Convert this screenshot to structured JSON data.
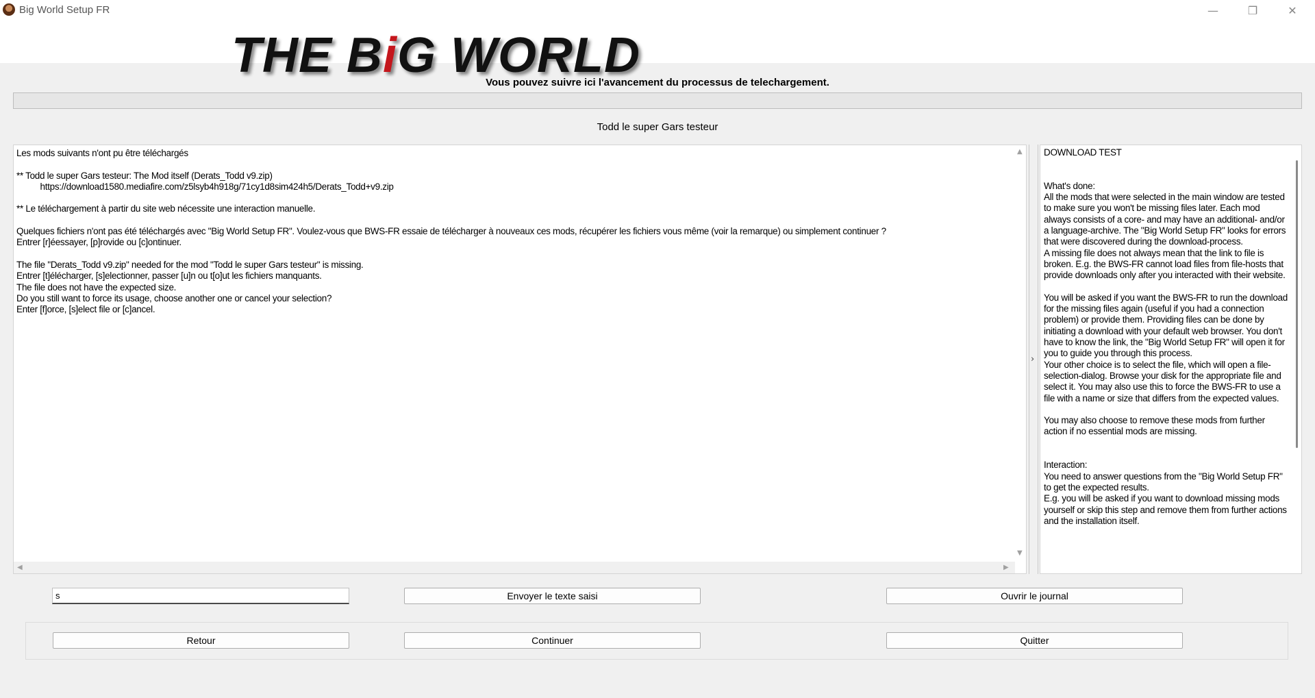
{
  "window": {
    "title": "Big World Setup FR",
    "controls": {
      "minimize": "—",
      "maximize": "❐",
      "close": "✕"
    }
  },
  "banner": {
    "logo_part1": "THE B",
    "logo_red_letter": "i",
    "logo_part2": "G WORLD",
    "logo_red_color": "#c4161c"
  },
  "header": {
    "heading": "Vous pouvez suivre ici l'avancement du processus de telechargement.",
    "progress_fraction": 0,
    "subheading": "Todd le super Gars testeur"
  },
  "log": {
    "text": "Les mods suivants n'ont pu être téléchargés\n\n** Todd le super Gars testeur: The Mod itself (Derats_Todd v9.zip)\n          https://download1580.mediafire.com/z5lsyb4h918g/71cy1d8sim424h5/Derats_Todd+v9.zip\n\n** Le téléchargement à partir du site web nécessite une interaction manuelle.\n\nQuelques fichiers n'ont pas été téléchargés avec \"Big World Setup FR\". Voulez-vous que BWS-FR essaie de télécharger à nouveaux ces mods, récupérer les fichiers vous même (voir la remarque) ou simplement continuer ?\nEntrer [r]éessayer, [p]rovide ou [c]ontinuer.\n\nThe file \"Derats_Todd v9.zip\" needed for the mod \"Todd le super Gars testeur\" is missing.\nEntrer [t]élécharger, [s]electionner, passer [u]n ou t[o]ut les fichiers manquants.\nThe file does not have the expected size.\nDo you still want to force its usage, choose another one or cancel your selection?\nEnter [f]orce, [s]elect file or [c]ancel."
  },
  "help": {
    "title": "DOWNLOAD TEST",
    "done_heading": "What's done:",
    "done_p1": "All the mods that were selected in the main window are tested to make sure you won't be missing files later. Each mod always consists of a core- and may have an additional- and/or a language-archive. The \"Big World Setup FR\" looks for errors that were discovered during the download-process.",
    "done_p2": "A missing file does not always mean that the link to file is broken. E.g. the BWS-FR cannot load files from file-hosts that provide downloads only after you interacted with their website.",
    "done_p3": "You will be asked if you want the BWS-FR to run the download for the missing files again (useful if you had a connection problem) or provide them. Providing files can be done by initiating a download with your default web browser. You don't have to know the link, the \"Big World Setup FR\" will open it for you to guide you through this process.",
    "done_p4": "Your other choice is to select the file, which will open a file-selection-dialog. Browse your disk for the appropriate file and select it. You may also use this to force the BWS-FR to use a file with a name or size that differs from the expected values.",
    "done_p5": "You may also choose to remove these mods from further action if no essential mods are missing.",
    "interaction_heading": "Interaction:",
    "interaction_p1": "You need to answer questions from the \"Big World Setup FR\" to get the expected results.",
    "interaction_p2": "E.g. you will be asked if you want to download missing mods yourself or skip this step and remove them from further actions and the installation itself."
  },
  "controls": {
    "input_value": "s",
    "send_label": "Envoyer le texte saisi",
    "open_log_label": "Ouvrir le journal",
    "back_label": "Retour",
    "continue_label": "Continuer",
    "quit_label": "Quitter"
  },
  "scroll_arrows": {
    "up": "▲",
    "down": "▼",
    "left": "◀",
    "right": "▶",
    "splitter": "›"
  }
}
